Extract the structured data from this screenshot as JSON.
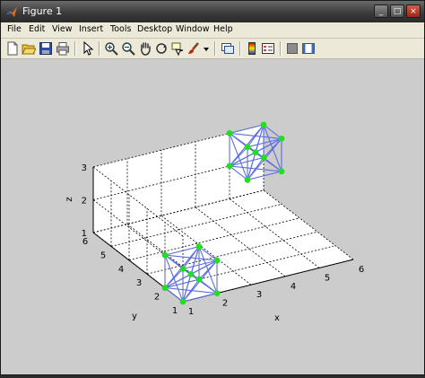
{
  "window": {
    "title": "Figure 1"
  },
  "title_buttons": {
    "minimize": "_",
    "maximize": "□",
    "close": "×"
  },
  "menu": [
    "File",
    "Edit",
    "View",
    "Insert",
    "Tools",
    "Desktop",
    "Window",
    "Help"
  ],
  "toolbar": {
    "items": [
      "new-figure-icon",
      "open-file-icon",
      "save-icon",
      "print-icon",
      "edit-plot-arrow-icon",
      "zoom-in-icon",
      "zoom-out-icon",
      "pan-hand-icon",
      "rotate-3d-icon",
      "data-cursor-icon",
      "brush-icon",
      "brush-dropdown-icon",
      "link-plot-icon",
      "colorbar-icon",
      "legend-icon",
      "hide-plot-tools-icon",
      "show-plot-tools-icon"
    ]
  },
  "colors": {
    "edge": "#5b6ee1",
    "vertex": "#22dd22",
    "figure_bg": "#cccccc"
  },
  "chart_data": {
    "type": "scatter",
    "title": "",
    "xlabel": "x",
    "ylabel": "y",
    "zlabel": "z",
    "xlim": [
      1,
      6
    ],
    "ylim": [
      1,
      6
    ],
    "zlim": [
      1,
      3
    ],
    "xticks": [
      "1",
      "2",
      "3",
      "4",
      "5",
      "6"
    ],
    "yticks": [
      "1",
      "2",
      "3",
      "4",
      "5",
      "6"
    ],
    "zticks": [
      "1",
      "2",
      "3"
    ],
    "grid": true,
    "view": "3d",
    "series": [
      {
        "points": [
          [
            1,
            1,
            1
          ],
          [
            2,
            1,
            1
          ],
          [
            1,
            2,
            1
          ],
          [
            2,
            2,
            1
          ],
          [
            1,
            1,
            2
          ],
          [
            2,
            1,
            2
          ],
          [
            1,
            2,
            2
          ],
          [
            2,
            2,
            2
          ],
          [
            1.5,
            1.5,
            1.5
          ]
        ]
      },
      {
        "points": [
          [
            5,
            5,
            2
          ],
          [
            6,
            5,
            2
          ],
          [
            5,
            6,
            2
          ],
          [
            6,
            6,
            2
          ],
          [
            5,
            5,
            3
          ],
          [
            6,
            5,
            3
          ],
          [
            5,
            6,
            3
          ],
          [
            6,
            6,
            3
          ],
          [
            5.5,
            5.5,
            2.5
          ]
        ]
      }
    ]
  }
}
